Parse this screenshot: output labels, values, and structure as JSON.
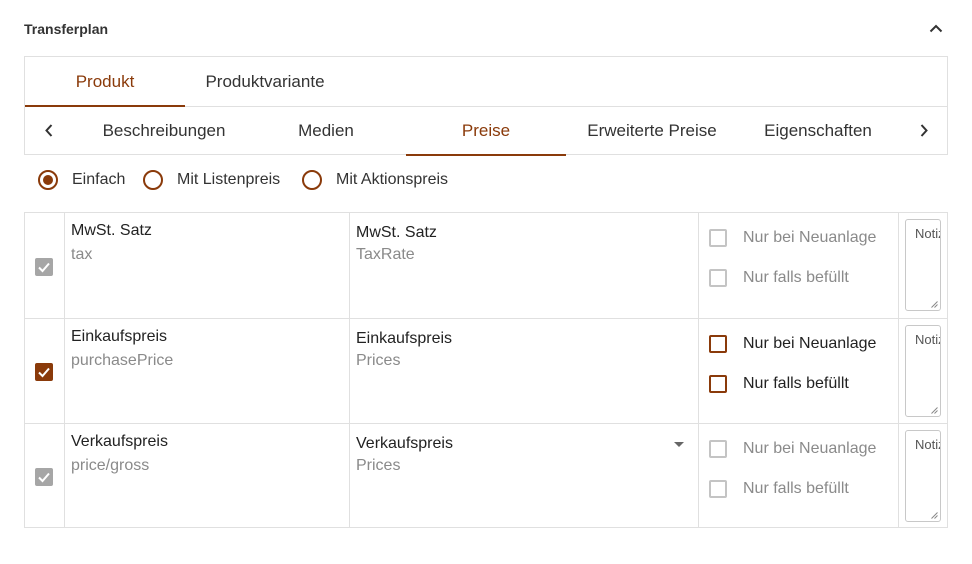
{
  "panel": {
    "title": "Transferplan"
  },
  "entity_tabs": [
    {
      "label": "Produkt",
      "active": true
    },
    {
      "label": "Produktvariante",
      "active": false
    }
  ],
  "section_tabs": [
    {
      "label": "Beschreibungen",
      "active": false
    },
    {
      "label": "Medien",
      "active": false
    },
    {
      "label": "Preise",
      "active": true
    },
    {
      "label": "Erweiterte Preise",
      "active": false
    },
    {
      "label": "Eigenschaften",
      "active": false
    }
  ],
  "price_mode": {
    "options": [
      {
        "label": "Einfach",
        "selected": true
      },
      {
        "label": "Mit Listenpreis",
        "selected": false
      },
      {
        "label": "Mit Aktionspreis",
        "selected": false
      }
    ]
  },
  "rows": [
    {
      "checked": true,
      "enabled": false,
      "source_label": "MwSt. Satz",
      "source_field": "tax",
      "target_label": "MwSt. Satz",
      "target_field": "TaxRate",
      "has_dropdown": false,
      "only_new": {
        "label": "Nur bei Neuanlage",
        "checked": false,
        "enabled": false
      },
      "only_filled": {
        "label": "Nur falls befüllt",
        "checked": false,
        "enabled": false
      },
      "note_placeholder": "Notiz"
    },
    {
      "checked": true,
      "enabled": true,
      "source_label": "Einkaufspreis",
      "source_field": "purchasePrice",
      "target_label": "Einkaufspreis",
      "target_field": "Prices",
      "has_dropdown": false,
      "only_new": {
        "label": "Nur bei Neuanlage",
        "checked": false,
        "enabled": true
      },
      "only_filled": {
        "label": "Nur falls befüllt",
        "checked": false,
        "enabled": true
      },
      "note_placeholder": "Notiz"
    },
    {
      "checked": true,
      "enabled": false,
      "source_label": "Verkaufspreis",
      "source_field": "price/gross",
      "target_label": "Verkaufspreis",
      "target_field": "Prices",
      "has_dropdown": true,
      "only_new": {
        "label": "Nur bei Neuanlage",
        "checked": false,
        "enabled": false
      },
      "only_filled": {
        "label": "Nur falls befüllt",
        "checked": false,
        "enabled": false
      },
      "note_placeholder": "Notiz"
    }
  ],
  "colors": {
    "accent": "#8a3a0a",
    "disabled": "#a6a6a6",
    "border": "#e0e0e0"
  },
  "icons": {
    "collapse": "chevron-up-icon",
    "scroll_left": "chevron-left-icon",
    "scroll_right": "chevron-right-icon",
    "dropdown": "caret-down-icon"
  }
}
